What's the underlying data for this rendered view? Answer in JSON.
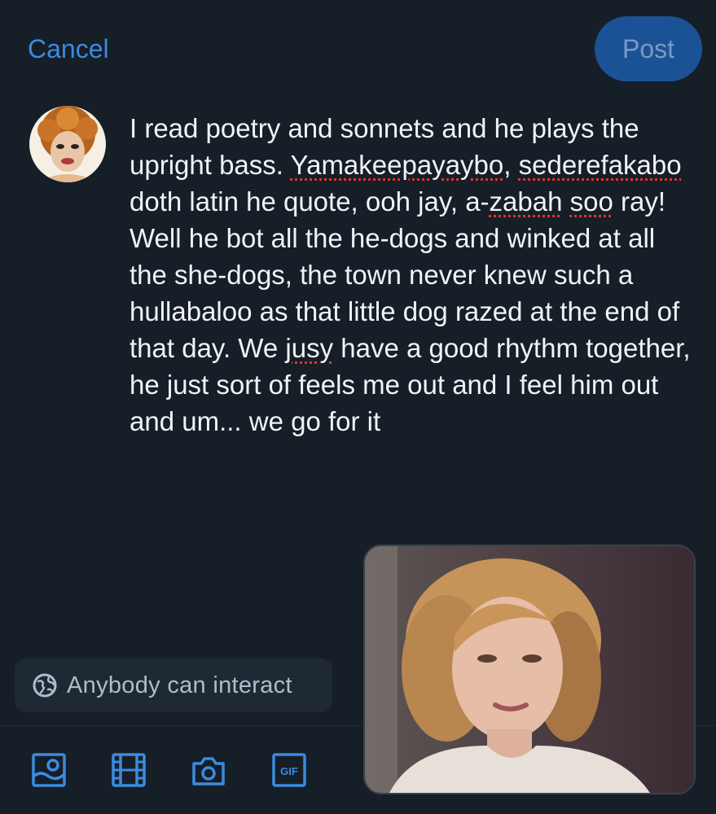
{
  "header": {
    "cancel_label": "Cancel",
    "post_label": "Post"
  },
  "composer": {
    "segments": [
      {
        "text": "I read poetry and sonnets and he plays the upright bass. ",
        "misspelled": false
      },
      {
        "text": "Yamakeepayaybo",
        "misspelled": true
      },
      {
        "text": ", ",
        "misspelled": false
      },
      {
        "text": "sederefakabo",
        "misspelled": true
      },
      {
        "text": " doth latin he quote, ooh jay, a-",
        "misspelled": false
      },
      {
        "text": "zabah",
        "misspelled": true
      },
      {
        "text": " ",
        "misspelled": false
      },
      {
        "text": "soo",
        "misspelled": true
      },
      {
        "text": " ray! Well he bot all the he-dogs and winked at all the she-dogs, the town never knew such a hullabaloo as that little dog razed at the end of that day. We ",
        "misspelled": false
      },
      {
        "text": "jusy",
        "misspelled": true
      },
      {
        "text": " have a good rhythm together, he just sort of feels me out and I feel him out and um... we go for it",
        "misspelled": false
      }
    ]
  },
  "interaction": {
    "label": "Anybody can interact",
    "icon": "globe-icon"
  },
  "toolbar": {
    "tools": [
      "image-icon",
      "film-icon",
      "camera-icon",
      "gif-icon"
    ],
    "gif_label": "GIF"
  },
  "colors": {
    "background": "#161e27",
    "accent": "#3b8be0",
    "post_button": "#1b5296",
    "spellcheck": "#e0342c"
  }
}
